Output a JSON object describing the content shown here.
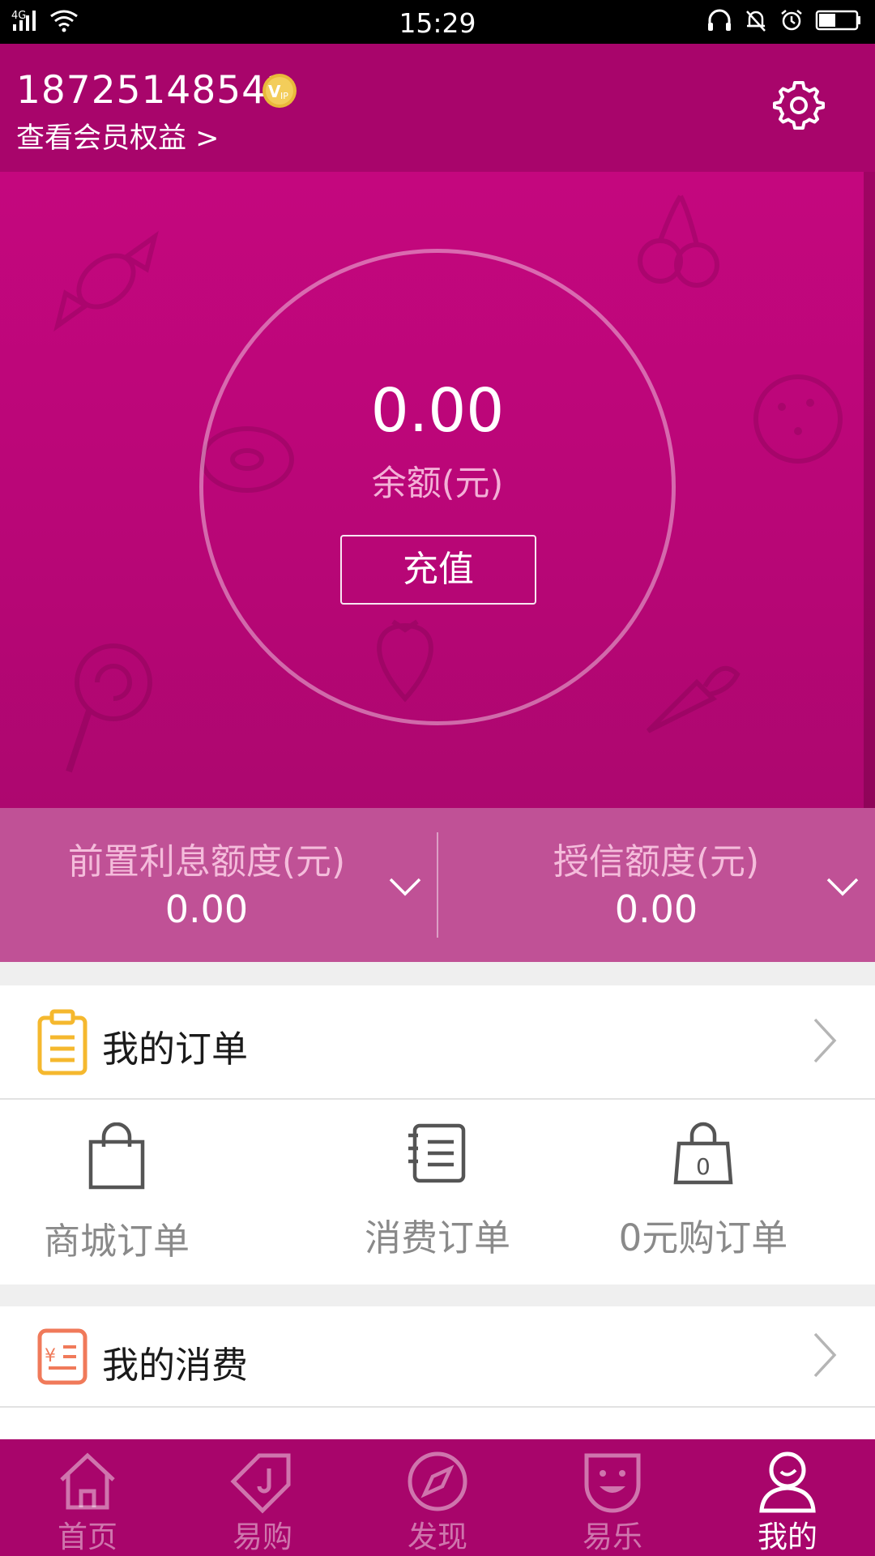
{
  "status_bar": {
    "network": "4G",
    "time": "15:29"
  },
  "header": {
    "phone": "18725148542",
    "vip_badge": "VIP",
    "member_link": "查看会员权益 >"
  },
  "balance": {
    "value": "0.00",
    "label": "余额(元)",
    "recharge_label": "充值"
  },
  "credit": {
    "prepaid_interest_label": "前置利息额度(元)",
    "prepaid_interest_value": "0.00",
    "credit_limit_label": "授信额度(元)",
    "credit_limit_value": "0.00"
  },
  "orders": {
    "title": "我的订单",
    "items": [
      {
        "label": "商城订单",
        "icon": "shopping-bag-icon"
      },
      {
        "label": "消费订单",
        "icon": "notebook-icon"
      },
      {
        "label": "0元购订单",
        "icon": "zero-bag-icon"
      }
    ]
  },
  "consumption": {
    "title": "我的消费"
  },
  "bottom_nav": {
    "items": [
      {
        "label": "首页",
        "icon": "home-icon",
        "active": false
      },
      {
        "label": "易购",
        "icon": "tag-icon",
        "active": false
      },
      {
        "label": "发现",
        "icon": "compass-icon",
        "active": false
      },
      {
        "label": "易乐",
        "icon": "smile-icon",
        "active": false
      },
      {
        "label": "我的",
        "icon": "user-icon",
        "active": true
      }
    ]
  },
  "colors": {
    "brand": "#a8056b",
    "hero": "#c4077e",
    "credit_band": "#c05196",
    "order_icon": "#f5b82e",
    "consume_icon": "#f07a5a"
  }
}
